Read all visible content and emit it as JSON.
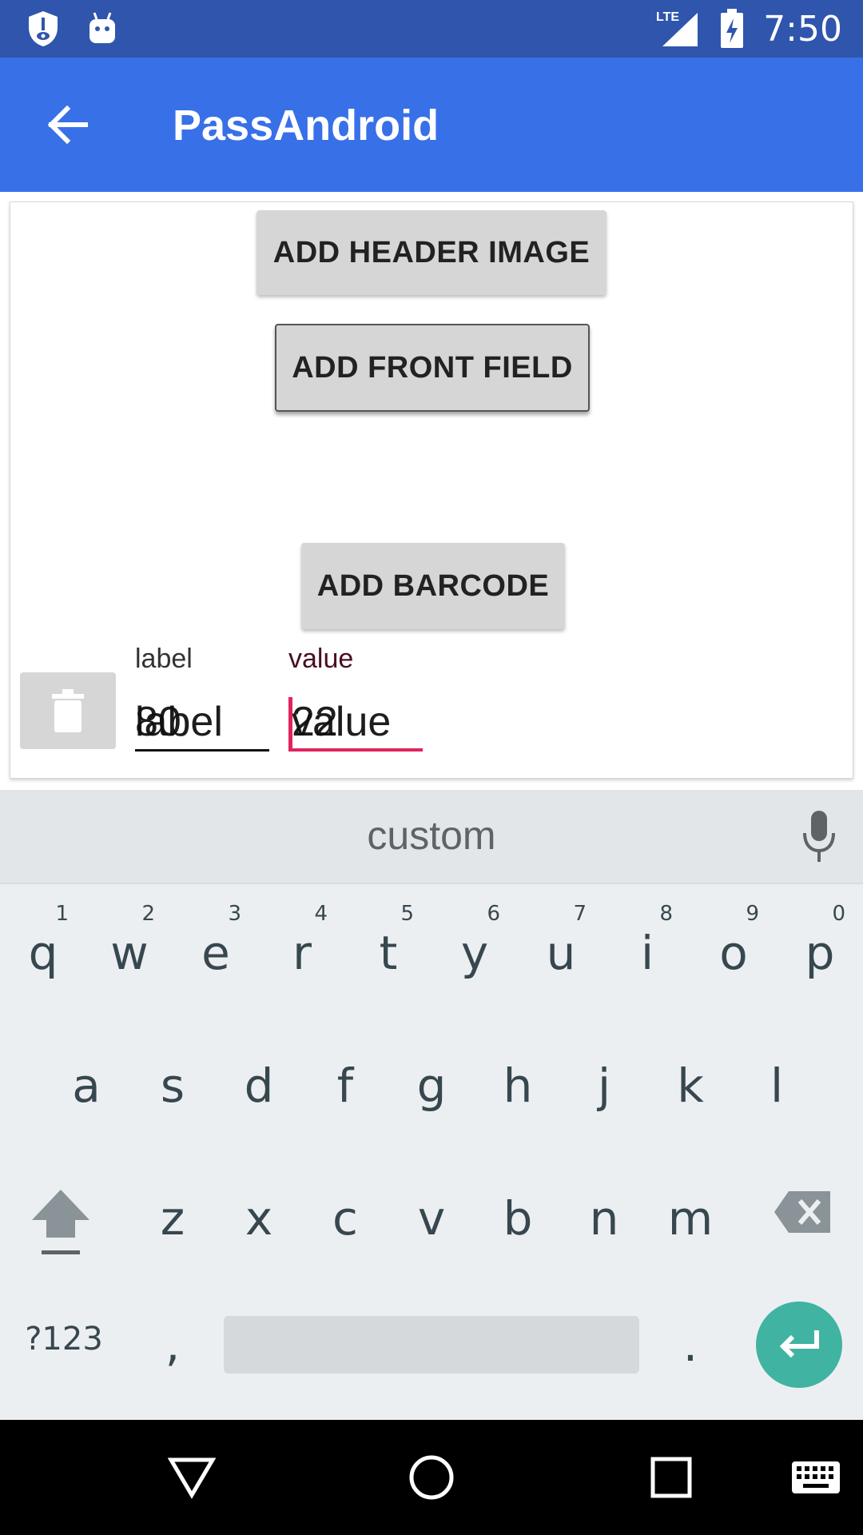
{
  "status_bar": {
    "time": "7:50",
    "network": "LTE",
    "icons": [
      "shield-notification-icon",
      "android-debug-icon",
      "lte-signal-icon",
      "battery-charging-icon"
    ]
  },
  "app_bar": {
    "title": "PassAndroid",
    "back_icon": "arrow-back-icon"
  },
  "content": {
    "add_header_image": "ADD HEADER IMAGE",
    "add_front_field": "ADD FRONT FIELD",
    "add_barcode": "ADD BARCODE",
    "field_row": {
      "delete_icon": "trash-icon",
      "label_caption": "label",
      "label_hint": "label",
      "label_value": "80",
      "value_caption": "value",
      "value_hint": "value",
      "value_value": "22"
    }
  },
  "keyboard": {
    "suggestion": "custom",
    "row1": [
      {
        "ch": "q",
        "num": "1"
      },
      {
        "ch": "w",
        "num": "2"
      },
      {
        "ch": "e",
        "num": "3"
      },
      {
        "ch": "r",
        "num": "4"
      },
      {
        "ch": "t",
        "num": "5"
      },
      {
        "ch": "y",
        "num": "6"
      },
      {
        "ch": "u",
        "num": "7"
      },
      {
        "ch": "i",
        "num": "8"
      },
      {
        "ch": "o",
        "num": "9"
      },
      {
        "ch": "p",
        "num": "0"
      }
    ],
    "row2": [
      "a",
      "s",
      "d",
      "f",
      "g",
      "h",
      "j",
      "k",
      "l"
    ],
    "row3": [
      "z",
      "x",
      "c",
      "v",
      "b",
      "n",
      "m"
    ],
    "symbols_key": "?123",
    "comma_key": ",",
    "period_key": ".",
    "accent_color": "#40b3a2"
  },
  "colors": {
    "status_bar": "#2f55ad",
    "app_bar": "#3870e8",
    "caret": "#e0245e"
  }
}
